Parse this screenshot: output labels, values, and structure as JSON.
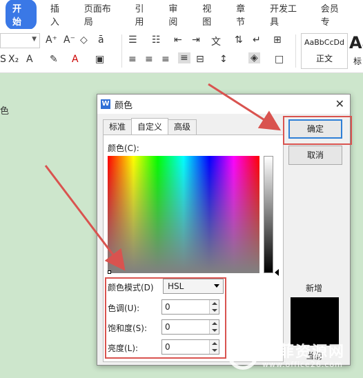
{
  "ribbon": {
    "tabs": [
      "开始",
      "插入",
      "页面布局",
      "引用",
      "审阅",
      "视图",
      "章节",
      "开发工具",
      "会员专"
    ],
    "style_sample": "AaBbCcDd",
    "style_name": "正文",
    "style_big": "Aa",
    "style_big_label": "标"
  },
  "document": {
    "text": "色"
  },
  "dialog": {
    "title": "颜色",
    "app_icon": "W",
    "close_glyph": "✕",
    "tabs": [
      "标准",
      "自定义",
      "高级"
    ],
    "active_tab": "自定义",
    "color_label": "颜色(C):",
    "mode_label": "颜色模式(D)",
    "mode_value": "HSL",
    "hue_label": "色调(U):",
    "hue_value": "0",
    "sat_label": "饱和度(S):",
    "sat_value": "0",
    "lum_label": "亮度(L):",
    "lum_value": "0",
    "ok_label": "确定",
    "cancel_label": "取消",
    "new_label": "新增",
    "current_label": "当前",
    "new_color": "#000000"
  },
  "annotation_color": "#d9534f",
  "watermark": {
    "text": "欧菲资源网",
    "url": "www.office26.com"
  }
}
